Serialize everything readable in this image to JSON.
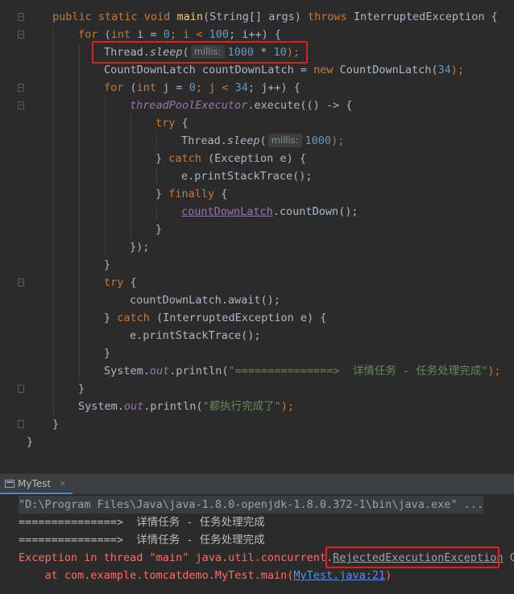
{
  "code": {
    "l1": {
      "mods": "public static void ",
      "method": "main",
      "params": "(String[] args) ",
      "throws": "throws",
      "exc": " InterruptedException {"
    },
    "l2": {
      "for": "for",
      "a": " (",
      "int": "int",
      "b": " i = ",
      "n0": "0",
      "c": "; i < ",
      "n100": "100",
      "d": "; i++) {"
    },
    "l3": {
      "a": "Thread.",
      "sleep": "sleep",
      "b": "(",
      "hint": "millis:",
      "n1": "1000",
      "op": " * ",
      "n2": "10",
      "c": ");"
    },
    "l4": {
      "a": "CountDownLatch countDownLatch = ",
      "new": "new",
      "b": " CountDownLatch(",
      "n": "34",
      "c": ");"
    },
    "l5": {
      "for": "for",
      "a": " (",
      "int": "int",
      "b": " j = ",
      "n0": "0",
      "c": "; j < ",
      "n": "34",
      "d": "; j++) {"
    },
    "l6": {
      "field": "threadPoolExecutor",
      "a": ".execute(() -> {"
    },
    "l7": {
      "try": "try",
      "a": " {"
    },
    "l8": {
      "a": "Thread.",
      "sleep": "sleep",
      "b": "(",
      "hint": "millis:",
      "n": "1000",
      "c": ");"
    },
    "l9": {
      "a": "} ",
      "catch": "catch",
      "b": " (Exception e) {"
    },
    "l10": {
      "a": "e.printStackTrace();"
    },
    "l11": {
      "a": "} ",
      "finally": "finally",
      "b": " {"
    },
    "l12": {
      "field": "countDownLatch",
      "a": ".countDown();"
    },
    "l13": {
      "a": "}"
    },
    "l14": {
      "a": "});"
    },
    "l15": {
      "a": "}"
    },
    "l16": {
      "try": "try",
      "a": " {"
    },
    "l17": {
      "a": "countDownLatch.await();"
    },
    "l18": {
      "a": "} ",
      "catch": "catch",
      "b": " (InterruptedException e) {"
    },
    "l19": {
      "a": "e.printStackTrace();"
    },
    "l20": {
      "a": "}"
    },
    "l21": {
      "a": "System.",
      "out": "out",
      "b": ".println(",
      "str": "\"===============>  详情任务 - 任务处理完成\"",
      "c": ");"
    },
    "l22": {
      "a": "}"
    },
    "l23": {
      "a": "System.",
      "out": "out",
      "b": ".println(",
      "str": "\"都执行完成了\"",
      "c": ");"
    },
    "l24": {
      "a": "}"
    },
    "l25": {
      "a": "}"
    }
  },
  "run_panel": {
    "tab_label": "MyTest",
    "close_glyph": "×"
  },
  "console": {
    "command": "\"D:\\Program Files\\Java\\java-1.8.0-openjdk-1.8.0.372-1\\bin\\java.exe\" ...",
    "out1": "===============>  详情任务 - 任务处理完成",
    "out2": "===============>  详情任务 - 任务处理完成",
    "exc_prefix": "Exception in thread \"main\" java.util.concurrent.",
    "exc_class": "RejectedExecutionException",
    "exc_suffix": " Cre",
    "at_prefix": "    at com.example.tomcatdemo.MyTest.main(",
    "at_link": "MyTest.java:21",
    "at_suffix": ")"
  },
  "colors": {
    "keyword": "#cc7832",
    "method": "#ffc66d",
    "number": "#6897bb",
    "string": "#6a8759",
    "field": "#9876aa",
    "error": "#ff6b68",
    "highlight_box": "#e02020"
  }
}
